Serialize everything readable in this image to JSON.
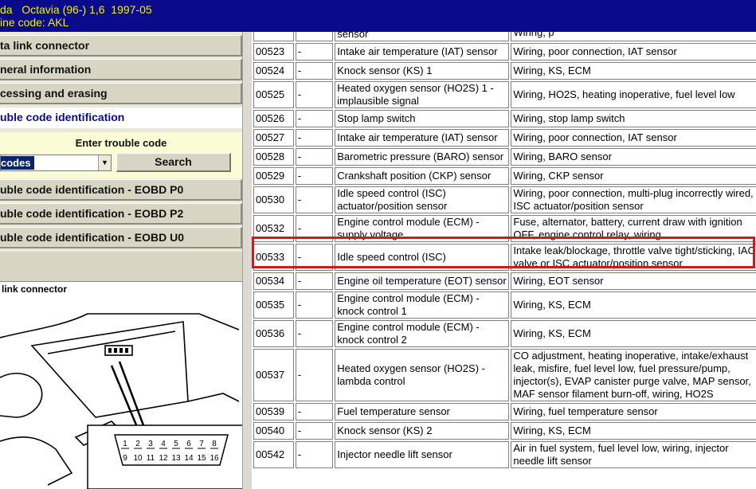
{
  "header": {
    "vehicle_line": "da   Octavia (96-) 1,6  1997-05",
    "engine_line": "ine code: AKL"
  },
  "menu": {
    "items": [
      {
        "label": "ta link connector"
      },
      {
        "label": "neral information"
      },
      {
        "label": "cessing and erasing"
      }
    ],
    "active_label": "uble code identification",
    "enter_label": "Enter trouble code",
    "combo_value": "codes",
    "search_label": "Search",
    "eobd_items": [
      {
        "label": "uble code identification - EOBD P0"
      },
      {
        "label": "uble code identification - EOBD P2"
      },
      {
        "label": "uble code identification - EOBD U0"
      }
    ]
  },
  "diagram": {
    "title": "link connector",
    "pins_top": [
      "1",
      "2",
      "3",
      "4",
      "5",
      "6",
      "7",
      "8"
    ],
    "pins_bottom": [
      "9",
      "10",
      "11",
      "12",
      "13",
      "14",
      "15",
      "16"
    ]
  },
  "colors": {
    "header_bg": "#0a0a8c",
    "header_text": "#f5f000",
    "highlight": "#cc1d1d"
  },
  "table": {
    "partial_top": {
      "component": "sensor",
      "cause": "Wiring, p"
    },
    "rows": [
      {
        "code": "00523",
        "flag": "-",
        "component": "Intake air temperature (IAT) sensor",
        "cause": "Wiring, poor connection, IAT sensor",
        "size": "r1"
      },
      {
        "code": "00524",
        "flag": "-",
        "component": "Knock sensor (KS) 1",
        "cause": "Wiring, KS, ECM",
        "size": "r1"
      },
      {
        "code": "00525",
        "flag": "-",
        "component": "Heated oxygen sensor (HO2S) 1 - implausible signal",
        "cause": "Wiring, HO2S, heating inoperative, fuel level low",
        "size": "r2"
      },
      {
        "code": "00526",
        "flag": "-",
        "component": "Stop lamp switch",
        "cause": "Wiring, stop lamp switch",
        "size": "r1"
      },
      {
        "code": "00527",
        "flag": "-",
        "component": "Intake air temperature (IAT) sensor",
        "cause": "Wiring, poor connection, IAT sensor",
        "size": "r1"
      },
      {
        "code": "00528",
        "flag": "-",
        "component": "Barometric pressure (BARO) sensor",
        "cause": "Wiring, BARO sensor",
        "size": "r1"
      },
      {
        "code": "00529",
        "flag": "-",
        "component": "Crankshaft position (CKP) sensor",
        "cause": "Wiring, CKP sensor",
        "size": "r1"
      },
      {
        "code": "00530",
        "flag": "-",
        "component": "Idle speed control (ISC) actuator/position sensor",
        "cause": "Wiring, poor connection, multi-plug incorrectly wired, ISC actuator/position sensor",
        "size": "r2"
      },
      {
        "code": "00532",
        "flag": "-",
        "component": "Engine control module (ECM) - supply voltage",
        "cause": "Fuse, alternator, battery, current draw with ignition OFF, engine control relay, wiring",
        "size": "r2"
      },
      {
        "code": "00533",
        "flag": "-",
        "component": "Idle speed control (ISC)",
        "cause": "Intake leak/blockage, throttle valve tight/sticking, IAC valve or ISC actuator/position sensor",
        "size": "r2"
      },
      {
        "code": "00534",
        "flag": "-",
        "component": "Engine oil temperature (EOT) sensor",
        "cause": "Wiring, EOT sensor",
        "size": "r1"
      },
      {
        "code": "00535",
        "flag": "-",
        "component": "Engine control module (ECM) - knock control 1",
        "cause": "Wiring, KS, ECM",
        "size": "r2"
      },
      {
        "code": "00536",
        "flag": "-",
        "component": "Engine control module (ECM) - knock control 2",
        "cause": "Wiring, KS, ECM",
        "size": "r2"
      },
      {
        "code": "00537",
        "flag": "-",
        "component": "Heated oxygen sensor (HO2S) - lambda control",
        "cause": "CO adjustment, heating inoperative, intake/exhaust leak, misfire, fuel level low, fuel pressure/pump, injector(s), EVAP canister purge valve, MAP sensor, MAF sensor filament burn-off, wiring, HO2S",
        "size": "r4"
      },
      {
        "code": "00539",
        "flag": "-",
        "component": "Fuel temperature sensor",
        "cause": "Wiring, fuel temperature sensor",
        "size": "r1"
      },
      {
        "code": "00540",
        "flag": "-",
        "component": "Knock sensor (KS) 2",
        "cause": "Wiring, KS, ECM",
        "size": "r1"
      },
      {
        "code": "00542",
        "flag": "-",
        "component": "Injector needle lift sensor",
        "cause": "Air in fuel system, fuel level low, wiring, injector needle lift sensor",
        "size": "r2"
      }
    ]
  }
}
